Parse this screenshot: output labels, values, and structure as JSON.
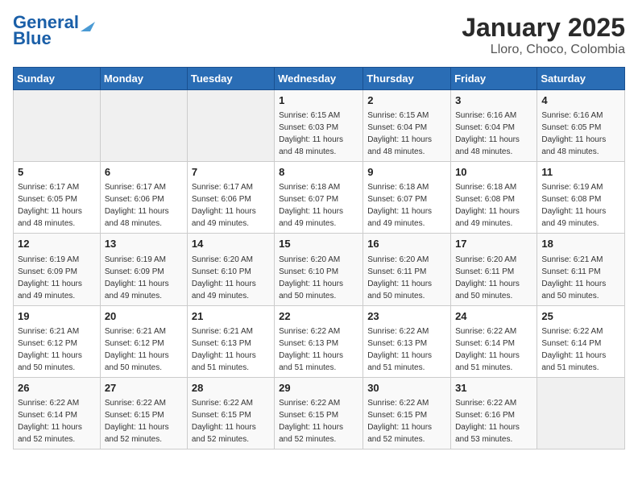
{
  "logo": {
    "line1": "General",
    "line2": "Blue"
  },
  "title": "January 2025",
  "subtitle": "Lloro, Choco, Colombia",
  "weekdays": [
    "Sunday",
    "Monday",
    "Tuesday",
    "Wednesday",
    "Thursday",
    "Friday",
    "Saturday"
  ],
  "weeks": [
    [
      {
        "day": "",
        "info": ""
      },
      {
        "day": "",
        "info": ""
      },
      {
        "day": "",
        "info": ""
      },
      {
        "day": "1",
        "info": "Sunrise: 6:15 AM\nSunset: 6:03 PM\nDaylight: 11 hours\nand 48 minutes."
      },
      {
        "day": "2",
        "info": "Sunrise: 6:15 AM\nSunset: 6:04 PM\nDaylight: 11 hours\nand 48 minutes."
      },
      {
        "day": "3",
        "info": "Sunrise: 6:16 AM\nSunset: 6:04 PM\nDaylight: 11 hours\nand 48 minutes."
      },
      {
        "day": "4",
        "info": "Sunrise: 6:16 AM\nSunset: 6:05 PM\nDaylight: 11 hours\nand 48 minutes."
      }
    ],
    [
      {
        "day": "5",
        "info": "Sunrise: 6:17 AM\nSunset: 6:05 PM\nDaylight: 11 hours\nand 48 minutes."
      },
      {
        "day": "6",
        "info": "Sunrise: 6:17 AM\nSunset: 6:06 PM\nDaylight: 11 hours\nand 48 minutes."
      },
      {
        "day": "7",
        "info": "Sunrise: 6:17 AM\nSunset: 6:06 PM\nDaylight: 11 hours\nand 49 minutes."
      },
      {
        "day": "8",
        "info": "Sunrise: 6:18 AM\nSunset: 6:07 PM\nDaylight: 11 hours\nand 49 minutes."
      },
      {
        "day": "9",
        "info": "Sunrise: 6:18 AM\nSunset: 6:07 PM\nDaylight: 11 hours\nand 49 minutes."
      },
      {
        "day": "10",
        "info": "Sunrise: 6:18 AM\nSunset: 6:08 PM\nDaylight: 11 hours\nand 49 minutes."
      },
      {
        "day": "11",
        "info": "Sunrise: 6:19 AM\nSunset: 6:08 PM\nDaylight: 11 hours\nand 49 minutes."
      }
    ],
    [
      {
        "day": "12",
        "info": "Sunrise: 6:19 AM\nSunset: 6:09 PM\nDaylight: 11 hours\nand 49 minutes."
      },
      {
        "day": "13",
        "info": "Sunrise: 6:19 AM\nSunset: 6:09 PM\nDaylight: 11 hours\nand 49 minutes."
      },
      {
        "day": "14",
        "info": "Sunrise: 6:20 AM\nSunset: 6:10 PM\nDaylight: 11 hours\nand 49 minutes."
      },
      {
        "day": "15",
        "info": "Sunrise: 6:20 AM\nSunset: 6:10 PM\nDaylight: 11 hours\nand 50 minutes."
      },
      {
        "day": "16",
        "info": "Sunrise: 6:20 AM\nSunset: 6:11 PM\nDaylight: 11 hours\nand 50 minutes."
      },
      {
        "day": "17",
        "info": "Sunrise: 6:20 AM\nSunset: 6:11 PM\nDaylight: 11 hours\nand 50 minutes."
      },
      {
        "day": "18",
        "info": "Sunrise: 6:21 AM\nSunset: 6:11 PM\nDaylight: 11 hours\nand 50 minutes."
      }
    ],
    [
      {
        "day": "19",
        "info": "Sunrise: 6:21 AM\nSunset: 6:12 PM\nDaylight: 11 hours\nand 50 minutes."
      },
      {
        "day": "20",
        "info": "Sunrise: 6:21 AM\nSunset: 6:12 PM\nDaylight: 11 hours\nand 50 minutes."
      },
      {
        "day": "21",
        "info": "Sunrise: 6:21 AM\nSunset: 6:13 PM\nDaylight: 11 hours\nand 51 minutes."
      },
      {
        "day": "22",
        "info": "Sunrise: 6:22 AM\nSunset: 6:13 PM\nDaylight: 11 hours\nand 51 minutes."
      },
      {
        "day": "23",
        "info": "Sunrise: 6:22 AM\nSunset: 6:13 PM\nDaylight: 11 hours\nand 51 minutes."
      },
      {
        "day": "24",
        "info": "Sunrise: 6:22 AM\nSunset: 6:14 PM\nDaylight: 11 hours\nand 51 minutes."
      },
      {
        "day": "25",
        "info": "Sunrise: 6:22 AM\nSunset: 6:14 PM\nDaylight: 11 hours\nand 51 minutes."
      }
    ],
    [
      {
        "day": "26",
        "info": "Sunrise: 6:22 AM\nSunset: 6:14 PM\nDaylight: 11 hours\nand 52 minutes."
      },
      {
        "day": "27",
        "info": "Sunrise: 6:22 AM\nSunset: 6:15 PM\nDaylight: 11 hours\nand 52 minutes."
      },
      {
        "day": "28",
        "info": "Sunrise: 6:22 AM\nSunset: 6:15 PM\nDaylight: 11 hours\nand 52 minutes."
      },
      {
        "day": "29",
        "info": "Sunrise: 6:22 AM\nSunset: 6:15 PM\nDaylight: 11 hours\nand 52 minutes."
      },
      {
        "day": "30",
        "info": "Sunrise: 6:22 AM\nSunset: 6:15 PM\nDaylight: 11 hours\nand 52 minutes."
      },
      {
        "day": "31",
        "info": "Sunrise: 6:22 AM\nSunset: 6:16 PM\nDaylight: 11 hours\nand 53 minutes."
      },
      {
        "day": "",
        "info": ""
      }
    ]
  ]
}
